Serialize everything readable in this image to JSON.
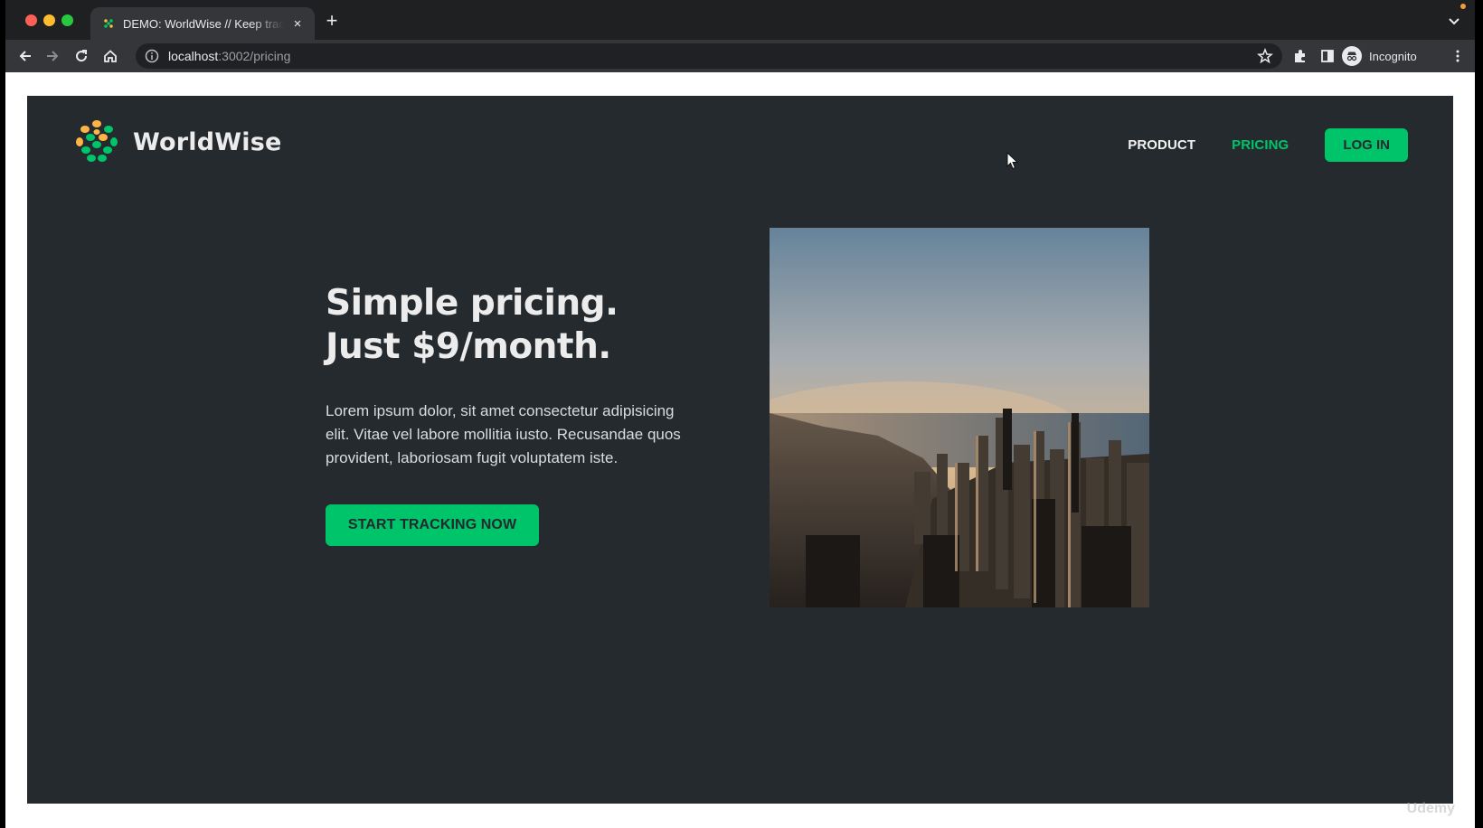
{
  "browser": {
    "tab_title": "DEMO: WorldWise // Keep track of your adventures",
    "tab_close": "×",
    "new_tab": "+",
    "url_host": "localhost",
    "url_path": ":3002/pricing",
    "profile_label": "Incognito",
    "icons": [
      "back-icon",
      "forward-icon",
      "reload-icon",
      "home-icon",
      "site-info-icon",
      "bookmark-star-icon",
      "extensions-icon",
      "side-panel-icon",
      "incognito-icon",
      "menu-icon",
      "tab-search-icon"
    ]
  },
  "app": {
    "brand": "WorldWise",
    "nav": {
      "product": "Product",
      "pricing": "Pricing",
      "login": "LOG IN"
    },
    "headline_line1": "Simple pricing.",
    "headline_line2": "Just $9/month.",
    "body": "Lorem ipsum dolor, sit amet consectetur adipisicing elit. Vitae vel labore mollitia iusto. Recusandae quos provident, laboriosam fugit voluptatem iste.",
    "cta": "START TRACKING NOW",
    "image_subject": "aerial-city-skyline-photo"
  },
  "watermark": "Udemy",
  "colors": {
    "accent": "#00c46a",
    "background": "#242a2e",
    "text": "#ececec"
  }
}
